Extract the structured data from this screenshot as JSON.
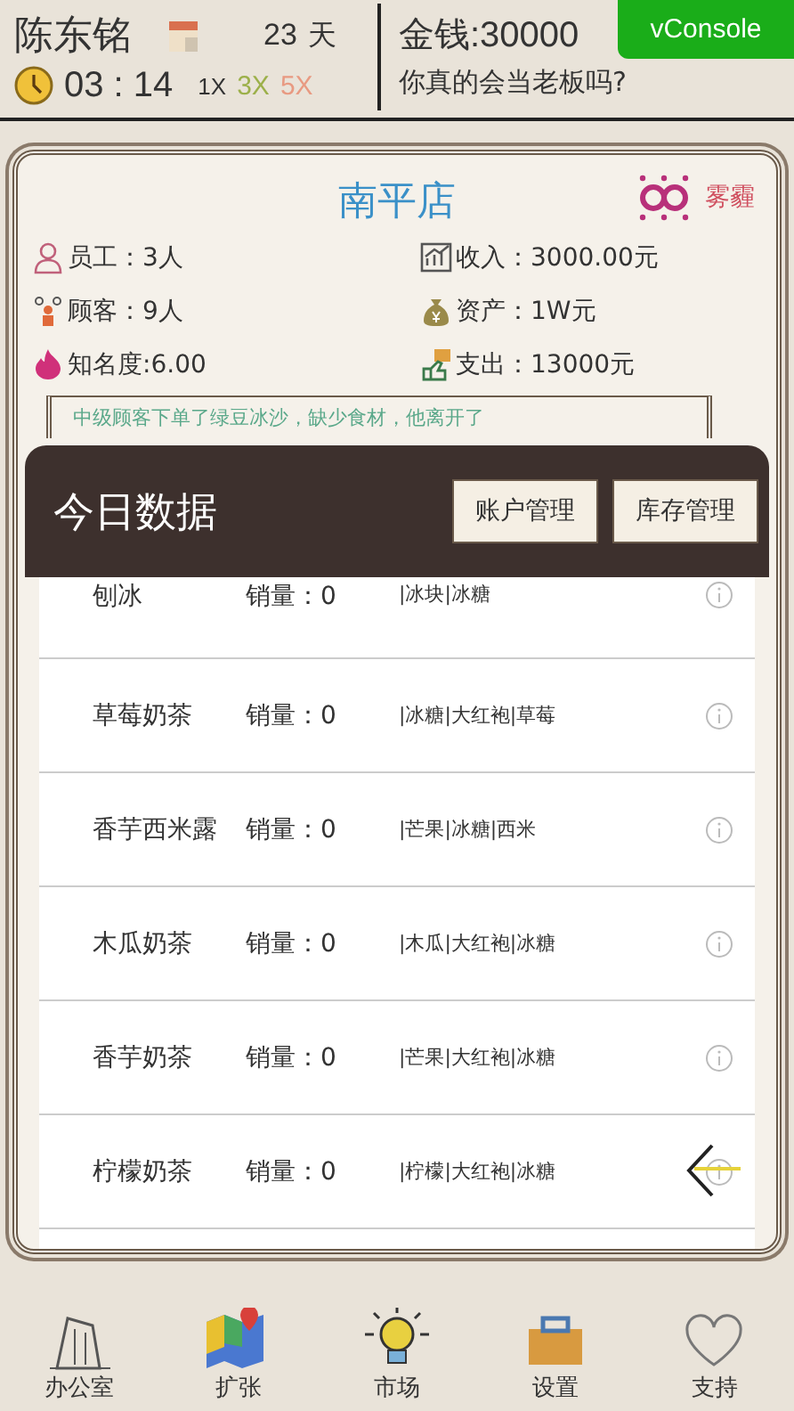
{
  "header": {
    "player": "陈东铭",
    "day": "23",
    "day_unit": "天",
    "time": "03 : 14",
    "speeds": [
      {
        "label": "1X",
        "color": "#333333"
      },
      {
        "label": "3X",
        "color": "#9cb04a"
      },
      {
        "label": "5X",
        "color": "#e89a82"
      }
    ],
    "money": "金钱:30000",
    "slogan": "你真的会当老板吗?",
    "console_button": "vConsole"
  },
  "store": {
    "name": "南平店",
    "weather": "雾霾",
    "stats": [
      {
        "text": "员工：3人"
      },
      {
        "text": "收入：3000.00元"
      },
      {
        "text": "顾客：9人"
      },
      {
        "text": "资产：1W元"
      },
      {
        "text": "知名度:6.00"
      },
      {
        "text": "支出：13000元"
      }
    ],
    "notice": "中级顾客下单了绿豆冰沙，缺少食材，他离开了"
  },
  "panel": {
    "title": "今日数据",
    "buttons": [
      "账户管理",
      "库存管理"
    ],
    "rows": [
      {
        "name": "刨冰",
        "sales": "销量：0",
        "ingredients": "|冰块|冰糖"
      },
      {
        "name": "草莓奶茶",
        "sales": "销量：0",
        "ingredients": "|冰糖|大红袍|草莓"
      },
      {
        "name": "香芋西米露",
        "sales": "销量：0",
        "ingredients": "|芒果|冰糖|西米"
      },
      {
        "name": "木瓜奶茶",
        "sales": "销量：0",
        "ingredients": "|木瓜|大红袍|冰糖"
      },
      {
        "name": "香芋奶茶",
        "sales": "销量：0",
        "ingredients": "|芒果|大红袍|冰糖"
      },
      {
        "name": "柠檬奶茶",
        "sales": "销量：0",
        "ingredients": "|柠檬|大红袍|冰糖"
      }
    ]
  },
  "nav": [
    {
      "label": "办公室"
    },
    {
      "label": "扩张"
    },
    {
      "label": "市场"
    },
    {
      "label": "设置"
    },
    {
      "label": "支持"
    }
  ]
}
